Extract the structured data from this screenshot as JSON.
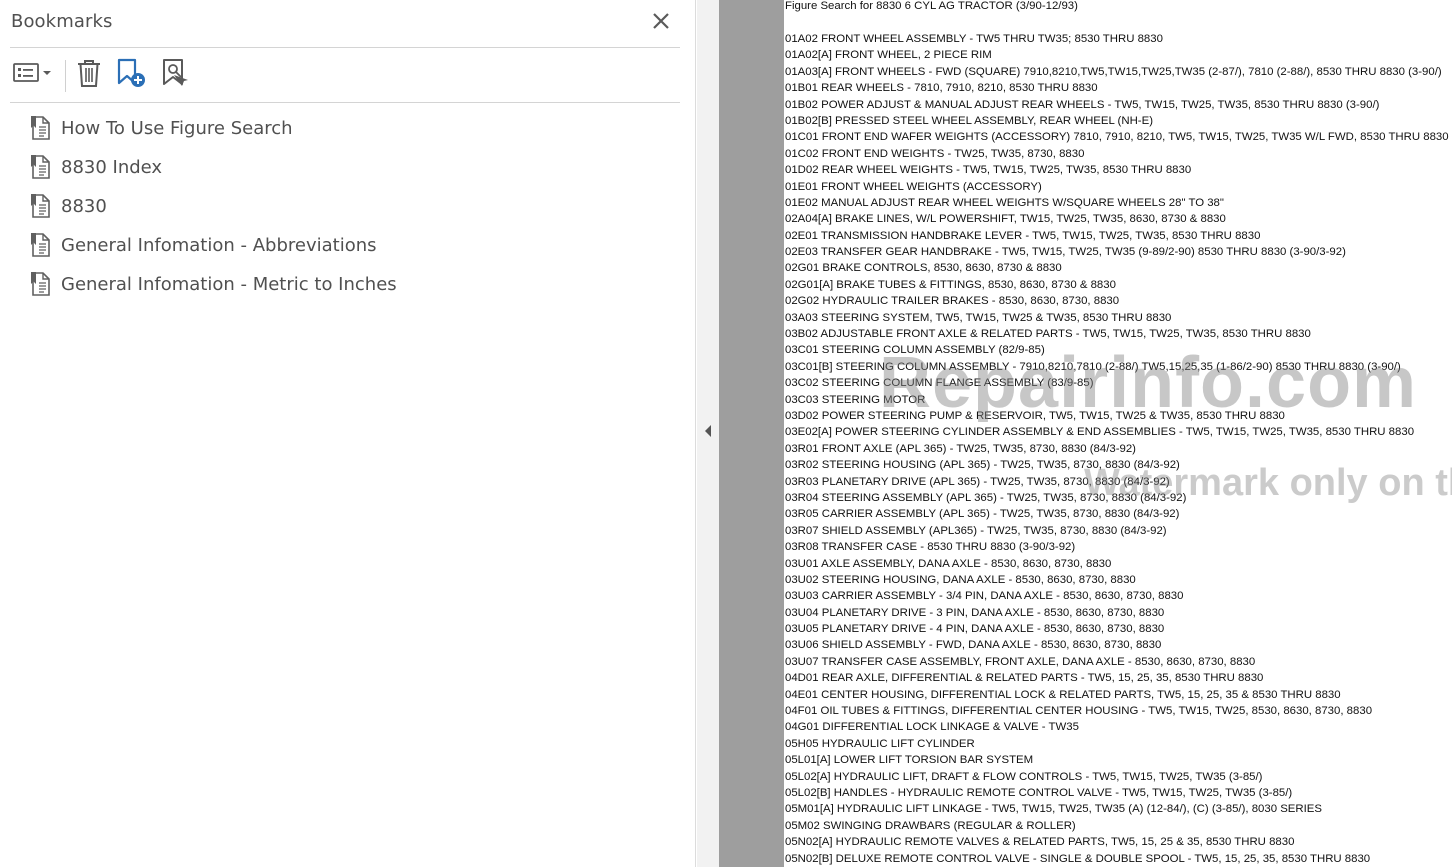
{
  "bookmarks_panel": {
    "title": "Bookmarks",
    "toolbar": {
      "options_icon": "list-options-icon",
      "delete_icon": "trash-icon",
      "new_bookmark_icon": "bookmark-add-icon",
      "expand_icon": "bookmark-search-icon"
    },
    "items": [
      {
        "label": "How To Use Figure Search",
        "icon": "bookmark-page-icon"
      },
      {
        "label": "8830 Index",
        "icon": "bookmark-page-icon"
      },
      {
        "label": "8830",
        "icon": "bookmark-page-icon"
      },
      {
        "label": "General Infomation - Abbreviations",
        "icon": "bookmark-page-icon"
      },
      {
        "label": "General Infomation - Metric to Inches",
        "icon": "bookmark-page-icon"
      }
    ]
  },
  "splitter": {
    "collapse_icon": "triangle-left-icon"
  },
  "document": {
    "heading": "Figure Search for 8830 6 CYL AG TRACTOR (3/90-12/93)",
    "lines": [
      "01A02 FRONT WHEEL ASSEMBLY - TW5 THRU TW35; 8530 THRU 8830",
      "01A02[A] FRONT WHEEL, 2 PIECE RIM",
      "01A03[A] FRONT WHEELS - FWD (SQUARE) 7910,8210,TW5,TW15,TW25,TW35 (2-87/), 7810 (2-88/), 8530 THRU 8830 (3-90/)",
      "01B01 REAR WHEELS - 7810, 7910, 8210, 8530 THRU 8830",
      "01B02 POWER ADJUST & MANUAL ADJUST REAR WHEELS - TW5, TW15, TW25, TW35, 8530 THRU 8830 (3-90/)",
      "01B02[B] PRESSED STEEL WHEEL ASSEMBLY, REAR WHEEL (NH-E)",
      "01C01 FRONT END WAFER WEIGHTS (ACCESSORY)  7810, 7910, 8210, TW5, TW15, TW25, TW35 W/L FWD, 8530 THRU 8830",
      "01C02 FRONT END WEIGHTS - TW25, TW35, 8730, 8830",
      "01D02 REAR WHEEL WEIGHTS - TW5, TW15, TW25, TW35, 8530 THRU 8830",
      "01E01 FRONT WHEEL WEIGHTS (ACCESSORY)",
      "01E02 MANUAL ADJUST REAR WHEEL WEIGHTS W/SQUARE WHEELS 28\" TO 38\"",
      "02A04[A] BRAKE LINES, W/L POWERSHIFT, TW15, TW25, TW35, 8630, 8730 & 8830",
      "02E01 TRANSMISSION HANDBRAKE LEVER - TW5, TW15, TW25, TW35, 8530 THRU 8830",
      "02E03 TRANSFER GEAR HANDBRAKE - TW5, TW15, TW25, TW35 (9-89/2-90) 8530 THRU 8830 (3-90/3-92)",
      "02G01 BRAKE CONTROLS, 8530, 8630, 8730 & 8830",
      "02G01[A] BRAKE TUBES & FITTINGS, 8530, 8630, 8730 & 8830",
      "02G02 HYDRAULIC TRAILER BRAKES - 8530, 8630, 8730, 8830",
      "03A03 STEERING SYSTEM, TW5, TW15, TW25 & TW35, 8530 THRU 8830",
      "03B02 ADJUSTABLE FRONT AXLE & RELATED PARTS - TW5, TW15, TW25, TW35, 8530 THRU 8830",
      "03C01 STEERING COLUMN ASSEMBLY (82/9-85)",
      "03C01[B] STEERING COLUMN ASSEMBLY - 7910,8210,7810 (2-88/) TW5,15,25,35 (1-86/2-90) 8530 THRU 8830 (3-90/)",
      "03C02 STEERING COLUMN FLANGE ASSEMBLY (83/9-85)",
      "03C03 STEERING MOTOR",
      "03D02 POWER STEERING PUMP & RESERVOIR, TW5, TW15, TW25 & TW35, 8530 THRU 8830",
      "03E02[A] POWER STEERING CYLINDER ASSEMBLY & END ASSEMBLIES - TW5, TW15, TW25, TW35, 8530 THRU 8830",
      "03R01 FRONT AXLE (APL 365) - TW25, TW35, 8730, 8830 (84/3-92)",
      "03R02 STEERING HOUSING (APL 365) - TW25, TW35, 8730, 8830 (84/3-92)",
      "03R03 PLANETARY DRIVE (APL 365) - TW25, TW35, 8730, 8830 (84/3-92)",
      "03R04 STEERING ASSEMBLY (APL 365) - TW25, TW35, 8730, 8830 (84/3-92)",
      "03R05 CARRIER ASSEMBLY (APL 365) - TW25, TW35, 8730, 8830 (84/3-92)",
      "03R07 SHIELD ASSEMBLY (APL365) - TW25, TW35, 8730, 8830 (84/3-92)",
      "03R08 TRANSFER CASE - 8530 THRU 8830 (3-90/3-92)",
      "03U01 AXLE ASSEMBLY, DANA AXLE - 8530, 8630, 8730, 8830",
      "03U02 STEERING HOUSING, DANA AXLE - 8530, 8630, 8730, 8830",
      "03U03 CARRIER ASSEMBLY - 3/4 PIN, DANA AXLE - 8530, 8630, 8730, 8830",
      "03U04 PLANETARY DRIVE - 3 PIN, DANA AXLE - 8530, 8630, 8730, 8830",
      "03U05 PLANETARY DRIVE - 4 PIN, DANA AXLE - 8530, 8630, 8730, 8830",
      "03U06 SHIELD ASSEMBLY - FWD, DANA AXLE - 8530, 8630, 8730, 8830",
      "03U07 TRANSFER CASE ASSEMBLY, FRONT AXLE, DANA AXLE - 8530, 8630, 8730, 8830",
      "04D01 REAR AXLE, DIFFERENTIAL & RELATED PARTS - TW5, 15, 25, 35, 8530 THRU 8830",
      "04E01 CENTER HOUSING, DIFFERENTIAL LOCK & RELATED PARTS, TW5, 15, 25, 35 & 8530 THRU 8830",
      "04F01 OIL TUBES & FITTINGS, DIFFERENTIAL CENTER HOUSING - TW5, TW15, TW25, 8530, 8630, 8730, 8830",
      "04G01 DIFFERENTIAL LOCK LINKAGE & VALVE - TW35",
      "05H05 HYDRAULIC LIFT CYLINDER",
      "05L01[A] LOWER LIFT TORSION BAR SYSTEM",
      "05L02[A] HYDRAULIC LIFT, DRAFT & FLOW CONTROLS - TW5, TW15, TW25, TW35 (3-85/)",
      "05L02[B] HANDLES - HYDRAULIC REMOTE CONTROL VALVE - TW5, TW15, TW25, TW35 (3-85/)",
      "05M01[A] HYDRAULIC LIFT LINKAGE - TW5, TW15, TW25, TW35 (A) (12-84/), (C) (3-85/), 8030 SERIES",
      "05M02 SWINGING DRAWBARS (REGULAR & ROLLER)",
      "05N02[A] HYDRAULIC REMOTE VALVES & RELATED PARTS, TW5, 15, 25 & 35, 8530 THRU 8830",
      "05N02[B] DELUXE REMOTE CONTROL VALVE - SINGLE & DOUBLE SPOOL - TW5, 15, 25, 35, 8530 THRU 8830"
    ],
    "watermark_main": "Repairinfo.com",
    "watermark_sub": "Watermark only on this sample"
  },
  "colors": {
    "panel_text": "#505050",
    "icon_blue": "#2b6fb6",
    "gutter_gray": "#9e9e9e"
  }
}
